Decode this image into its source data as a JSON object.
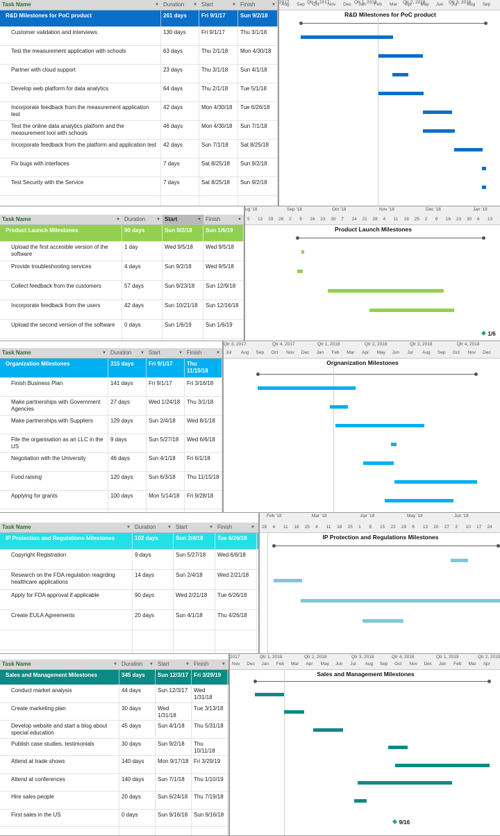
{
  "sections": [
    {
      "title": "R&D Milestones for PoC product",
      "color": "#0a6fc9",
      "bar_color": "#0a6fc9",
      "columns": [
        "Task Name",
        "Duration",
        "Start",
        "Finish"
      ],
      "sorted_col": -1,
      "timescale": {
        "top": [
          "2017",
          "Qtr 4, 2017",
          "Qtr 1, 2018",
          "Qtr 2, 2018",
          "Qtr 3, 2018"
        ],
        "bottom": [
          "Aug",
          "Sep",
          "Oct",
          "Nov",
          "Dec",
          "Jan",
          "Feb",
          "Mar",
          "Apr",
          "May",
          "Jun",
          "Jul",
          "Aug",
          "Sep"
        ]
      },
      "summary": {
        "name": "R&D Milestones for PoC product",
        "duration": "261 days",
        "start": "Fri 9/1/17",
        "finish": "Sun 9/2/18"
      },
      "tasks": [
        {
          "name": "Customer validation and interviews",
          "duration": "130 days",
          "start": "Fri 9/1/17",
          "finish": "Thu 3/1/18"
        },
        {
          "name": "Test the measurement application with schools",
          "duration": "63 days",
          "start": "Thu 2/1/18",
          "finish": "Mon 4/30/18"
        },
        {
          "name": "Partner with cloud support",
          "duration": "23 days",
          "start": "Thu 3/1/18",
          "finish": "Sun 4/1/18"
        },
        {
          "name": "Develop web platform for data analytics",
          "duration": "64 days",
          "start": "Thu 2/1/18",
          "finish": "Tue 5/1/18"
        },
        {
          "name": "Incorporate feedback from the measurement application test",
          "duration": "42 days",
          "start": "Mon 4/30/18",
          "finish": "Tue 6/26/18"
        },
        {
          "name": "Test the online data analytics platform and the measurement tool with schools",
          "duration": "46 days",
          "start": "Mon 4/30/18",
          "finish": "Sun 7/1/18"
        },
        {
          "name": "Incorporate feedback from the platform and application test",
          "duration": "42 days",
          "start": "Sun 7/1/18",
          "finish": "Sat 8/25/18"
        },
        {
          "name": "Fix bugs with interfaces",
          "duration": "7 days",
          "start": "Sat 8/25/18",
          "finish": "Sun 9/2/18"
        },
        {
          "name": "Test Security with the Service",
          "duration": "7 days",
          "start": "Sat 8/25/18",
          "finish": "Sun 9/2/18"
        }
      ],
      "milestone_label": ""
    },
    {
      "title": "Product Launch Milestones",
      "color": "#92d050",
      "bar_color": "#92d050",
      "columns": [
        "Task Name",
        "Duration",
        "Start",
        "Finish"
      ],
      "sorted_col": 2,
      "timescale": {
        "top": [
          "ug '18",
          "Sep '18",
          "Oct '18",
          "Nov '18",
          "Dec '18",
          "Jan '19"
        ],
        "bottom": [
          "5",
          "12",
          "19",
          "26",
          "2",
          "9",
          "16",
          "23",
          "30",
          "7",
          "14",
          "21",
          "28",
          "4",
          "11",
          "18",
          "25",
          "2",
          "9",
          "16",
          "23",
          "30",
          "6",
          "13"
        ]
      },
      "summary": {
        "name": "Product Launch Milestones",
        "duration": "90 days",
        "start": "Sun 9/2/18",
        "finish": "Sun 1/6/19"
      },
      "tasks": [
        {
          "name": "Upload the first accesible version of the software",
          "duration": "1 day",
          "start": "Wed 9/5/18",
          "finish": "Wed 9/5/18"
        },
        {
          "name": "Provide troubleshooting services",
          "duration": "4 days",
          "start": "Sun 9/2/18",
          "finish": "Wed 9/5/18"
        },
        {
          "name": "Collect feedback from the customers",
          "duration": "57 days",
          "start": "Sun 9/23/18",
          "finish": "Sun 12/9/18"
        },
        {
          "name": "Incorporate feedback from the users",
          "duration": "42 days",
          "start": "Sun 10/21/18",
          "finish": "Sun 12/16/18"
        },
        {
          "name": "Upload the second version of the software",
          "duration": "0 days",
          "start": "Sun 1/6/19",
          "finish": "Sun 1/6/19"
        }
      ],
      "milestone_label": "1/6"
    },
    {
      "title": "Orgnanization Milestones",
      "color": "#00b0f0",
      "bar_color": "#00b0f0",
      "columns": [
        "Task Name",
        "Duration",
        "Start",
        "Finish"
      ],
      "sorted_col": -1,
      "timescale": {
        "top": [
          "Qtr 3, 2017",
          "Qtr 4, 2017",
          "Qtr 1, 2018",
          "Qtr 2, 2018",
          "Qtr 3, 2018",
          "Qtr 4, 2018"
        ],
        "bottom": [
          "Jul",
          "Aug",
          "Sep",
          "Oct",
          "Nov",
          "Dec",
          "Jan",
          "Feb",
          "Mar",
          "Apr",
          "May",
          "Jun",
          "Jul",
          "Aug",
          "Sep",
          "Oct",
          "Nov",
          "Dec"
        ]
      },
      "summary": {
        "name": "Organization Milestones",
        "duration": "315 days",
        "start": "Fri 9/1/17",
        "finish": "Thu 11/15/18"
      },
      "tasks": [
        {
          "name": "Finish Business Plan",
          "duration": "141 days",
          "start": "Fri 9/1/17",
          "finish": "Fri 3/16/18"
        },
        {
          "name": "Make partnerships with Government Agencies",
          "duration": "27 days",
          "start": "Wed 1/24/18",
          "finish": "Thu 3/1/18"
        },
        {
          "name": "Make partnerships with Suppliers",
          "duration": "129 days",
          "start": "Sun 2/4/18",
          "finish": "Wed 8/1/18"
        },
        {
          "name": "File the organisation as an LLC in the US",
          "duration": "9 days",
          "start": "Sun 5/27/18",
          "finish": "Wed 6/6/18"
        },
        {
          "name": "Negotiation with the University",
          "duration": "46 days",
          "start": "Sun 4/1/18",
          "finish": "Fri 6/1/18"
        },
        {
          "name": "Fund raising",
          "duration": "120 days",
          "start": "Sun 6/3/18",
          "finish": "Thu 11/15/18"
        },
        {
          "name": "Applying for grants",
          "duration": "100 days",
          "start": "Mon 5/14/18",
          "finish": "Fri 9/28/18"
        }
      ],
      "milestone_label": ""
    },
    {
      "title": "IP Protection and Regulations Milestones",
      "color": "#22e0e6",
      "bar_color": "#7ec8d8",
      "columns": [
        "Task Name",
        "Duration",
        "Start",
        "Finish"
      ],
      "sorted_col": -1,
      "timescale": {
        "top": [
          "Feb '18",
          "Mar '18",
          "Apr '18",
          "May '18",
          "Jun '18"
        ],
        "bottom": [
          "28",
          "4",
          "11",
          "18",
          "25",
          "4",
          "11",
          "18",
          "25",
          "1",
          "8",
          "15",
          "22",
          "29",
          "6",
          "13",
          "20",
          "27",
          "3",
          "10",
          "17",
          "24"
        ]
      },
      "summary": {
        "name": "IP Protection and Regulations Milestones",
        "duration": "102 days",
        "start": "Sun 2/4/18",
        "finish": "Tue 6/26/18"
      },
      "tasks": [
        {
          "name": "Copyright Registration",
          "duration": "9 days",
          "start": "Sun 5/27/18",
          "finish": "Wed 6/6/18"
        },
        {
          "name": "Research on the FDA regulation reagrding healthcare applications",
          "duration": "14 days",
          "start": "Sun 2/4/18",
          "finish": "Wed 2/21/18"
        },
        {
          "name": "Apply for FDA approval if applicable",
          "duration": "90 days",
          "start": "Wed 2/21/18",
          "finish": "Tue 6/26/18"
        },
        {
          "name": "Create EULA Agreements",
          "duration": "20 days",
          "start": "Sun 4/1/18",
          "finish": "Thu 4/26/18"
        }
      ],
      "milestone_label": ""
    },
    {
      "title": "Sales and Management Milestones",
      "color": "#0d8a85",
      "bar_color": "#0d8a85",
      "columns": [
        "Task Name",
        "Duration",
        "Start",
        "Finish"
      ],
      "sorted_col": -1,
      "timescale": {
        "top": [
          "2017",
          "Qtr 1, 2018",
          "Qtr 2, 2018",
          "Qtr 3, 2018",
          "Qtr 4, 2018",
          "Qtr 1, 2019",
          "Qtr 2, 2019"
        ],
        "bottom": [
          "Nov",
          "Dec",
          "Jan",
          "Feb",
          "Mar",
          "Apr",
          "May",
          "Jun",
          "Jul",
          "Aug",
          "Sep",
          "Oct",
          "Nov",
          "Dec",
          "Jan",
          "Feb",
          "Mar",
          "Apr"
        ]
      },
      "summary": {
        "name": "Sales and Management Milestones",
        "duration": "345 days",
        "start": "Sun 12/3/17",
        "finish": "Fri 3/29/19"
      },
      "tasks": [
        {
          "name": "Conduct market analysis",
          "duration": "44 days",
          "start": "Sun 12/3/17",
          "finish": "Wed 1/31/18"
        },
        {
          "name": "Create marketing plan",
          "duration": "30 days",
          "start": "Wed 1/31/18",
          "finish": "Tue 3/13/18"
        },
        {
          "name": "Develop website and start a blog about special education",
          "duration": "45 days",
          "start": "Sun 4/1/18",
          "finish": "Thu 5/31/18"
        },
        {
          "name": "Publish case studies, testimonials",
          "duration": "30 days",
          "start": "Sun 9/2/18",
          "finish": "Thu 10/11/18"
        },
        {
          "name": "Attend at trade shows",
          "duration": "140 days",
          "start": "Mon 9/17/18",
          "finish": "Fri 3/29/19"
        },
        {
          "name": "Attend at conferences",
          "duration": "140 days",
          "start": "Sun 7/1/18",
          "finish": "Thu 1/10/19"
        },
        {
          "name": "Hire sales people",
          "duration": "20 days",
          "start": "Sun 6/24/18",
          "finish": "Thu 7/19/18"
        },
        {
          "name": "First sales in the US",
          "duration": "0 days",
          "start": "Sun 9/16/18",
          "finish": "Sun 9/16/18"
        }
      ],
      "milestone_label": "9/16"
    }
  ]
}
